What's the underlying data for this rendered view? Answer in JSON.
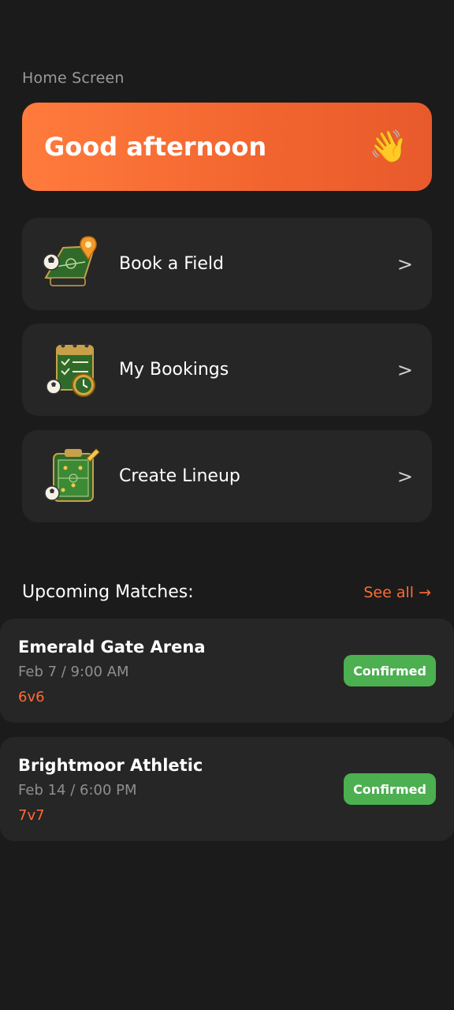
{
  "screen": {
    "label": "Home Screen"
  },
  "greeting": {
    "text": "Good afternoon",
    "emoji": "👋"
  },
  "menu": [
    {
      "label": "Book a Field",
      "icon": "field-map-pin-icon",
      "chevron": ">"
    },
    {
      "label": "My Bookings",
      "icon": "calendar-clock-icon",
      "chevron": ">"
    },
    {
      "label": "Create Lineup",
      "icon": "tactics-clipboard-icon",
      "chevron": ">"
    }
  ],
  "upcoming": {
    "title": "Upcoming Matches:",
    "see_all": "See all →",
    "matches": [
      {
        "name": "Emerald Gate Arena",
        "datetime": "Feb 7 / 9:00 AM",
        "format": "6v6",
        "status": "Confirmed"
      },
      {
        "name": "Brightmoor Athletic",
        "datetime": "Feb 14 / 6:00 PM",
        "format": "7v7",
        "status": "Confirmed"
      }
    ]
  },
  "colors": {
    "background": "#1b1b1b",
    "card": "#262626",
    "accent": "#ff6b35",
    "confirmed": "#4caf50"
  }
}
